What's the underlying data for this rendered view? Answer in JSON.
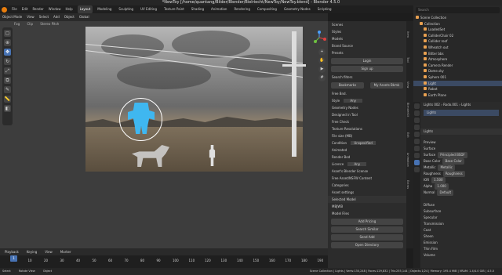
{
  "window": {
    "title": "*NewToy [/home/quantang/Bilder/Blender/Bielriecht/NewToy/NewToy.blend] - Blender 4.5.0"
  },
  "menu": {
    "items": [
      "File",
      "Edit",
      "Render",
      "Window",
      "Help"
    ],
    "workspaces": [
      "Layout",
      "Modeling",
      "Sculpting",
      "UV Editing",
      "Texture Paint",
      "Shading",
      "Animation",
      "Rendering",
      "Compositing",
      "Geometry Nodes",
      "Scripting"
    ],
    "active_workspace": "Layout",
    "scene": "Scene",
    "view_layer": "ViewLayer"
  },
  "viewport": {
    "mode": "Object Mode",
    "menus": [
      "View",
      "Select",
      "Add",
      "Object"
    ],
    "orientation": "Global",
    "sub": [
      "Fog",
      "Clip",
      "Stereo Pitch"
    ],
    "axes": [
      "X",
      "Y",
      "Z"
    ]
  },
  "addon_panel": {
    "items": [
      "Scenes",
      "Styles",
      "Models",
      "Brand Source",
      "Presets"
    ],
    "buttons_top": [
      "Login",
      "Sign up"
    ],
    "search_label": "Search filters",
    "tabs": [
      "Bookmarks",
      "My Assets Bkmk"
    ],
    "rows": [
      "Free Bnd.",
      "Style",
      "Geometry Nodes",
      "Designed in Tool",
      "Free Check",
      "Texture Resolutions",
      "File size (MB)",
      "Condition",
      "Animated",
      "Render Bed",
      "Licence",
      "Asset's Blender license",
      "Free Asset/NSFW Content",
      "Categories",
      "Asset settings"
    ],
    "style_value": "Any",
    "condition_value": "Unspecified",
    "licence_value": "Any",
    "selected_header": "Selected Model",
    "selected_fields": [
      "MBJWB",
      "Model Files"
    ],
    "buttons_bottom": [
      "Add Pricing",
      "Search Similar",
      "Send Add",
      "Open Directory"
    ]
  },
  "side_tabs": [
    "Item",
    "Tool",
    "View",
    "BlenderKit",
    "Edit",
    "Animation",
    "Extras"
  ],
  "outliner": {
    "search_placeholder": "Search",
    "items": [
      "Scene Collection",
      "Collection",
      "LoadedSet",
      "ColliderChair 02",
      "Collider roof",
      "Wheatch out",
      "Bitter bbs",
      "Atmosphere",
      "Camera Render",
      "Dome.sky",
      "Sphere 001",
      "Light",
      "Robot",
      "Earth Plane"
    ],
    "selected": "Light"
  },
  "properties": {
    "header": [
      "Lights 002",
      "Rodo.001",
      "Lights"
    ],
    "object_name": "Lights",
    "sections": [
      "Preview",
      "Surface"
    ],
    "surface_label": "Surface",
    "surface_value": "Principled BSDF",
    "base_color_label": "Base Color",
    "base_color_value": "Base Color",
    "metallic_label": "Metallic",
    "metallic_value": "Metallic",
    "roughness_label": "Roughness",
    "roughness_value": "Roughness",
    "ior_label": "IOR",
    "ior_value": "1.500",
    "alpha_label": "Alpha",
    "alpha_value": "1.000",
    "normal_label": "Normal",
    "normal_value": "Default",
    "more_sections": [
      "Diffuse",
      "Subsurface",
      "Specular",
      "Transmission",
      "Coat",
      "Sheen",
      "Emission",
      "Thin Film",
      "Volume"
    ]
  },
  "timeline": {
    "menus": [
      "Playback",
      "Keying",
      "View",
      "Marker"
    ],
    "current_frame": "1",
    "ticks": [
      "0",
      "10",
      "20",
      "30",
      "40",
      "50",
      "60",
      "70",
      "80",
      "90",
      "100",
      "110",
      "120",
      "130",
      "140",
      "150",
      "160",
      "170",
      "180",
      "190"
    ]
  },
  "statusbar": {
    "left": [
      "Select",
      "Rotate View",
      "Object"
    ],
    "right": "Scene Collection | Lights | Verts:130,248 | Faces:129,832 | Tris:255,144 | Objects:1/24 | Memory: 195.4 MiB | VRAM: 1.4/4.0 GiB | 4.5.0"
  },
  "colors": {
    "accent": "#4772b3",
    "selection": "#3fb7f0",
    "blender_orange": "#e87d0d"
  },
  "icons": [
    "select-icon",
    "cursor-icon",
    "move-icon",
    "rotate-icon",
    "scale-icon",
    "transform-icon",
    "annotate-icon",
    "measure-icon",
    "add-cube-icon",
    "zoom-icon",
    "hand-icon",
    "camera-icon",
    "grid-icon"
  ]
}
